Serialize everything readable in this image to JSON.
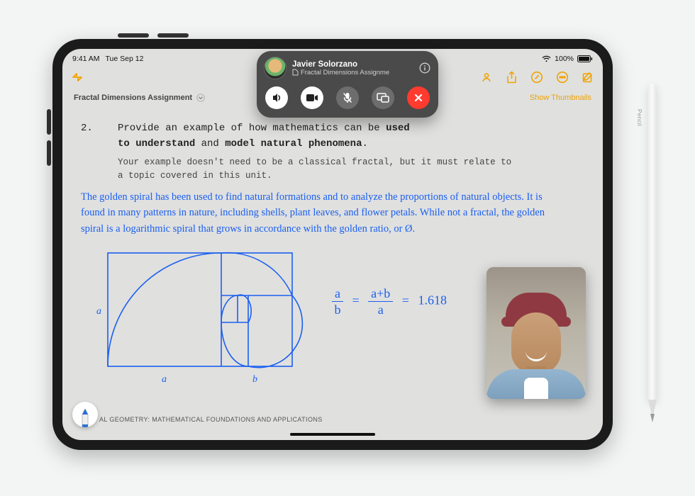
{
  "status": {
    "time": "9:41 AM",
    "date": "Tue Sep 12",
    "battery_pct": "100%"
  },
  "toolbar": {
    "icons": {
      "collapse": "collapse-icon",
      "collab": "collaborate-icon",
      "share": "share-icon",
      "markup": "markup-icon",
      "more": "ellipsis-circle-icon",
      "compose": "compose-icon"
    }
  },
  "titlebar": {
    "doc_title": "Fractal Dimensions Assignment",
    "show_thumbs": "Show Thumbnails"
  },
  "document": {
    "q_num": "2.",
    "q_line1_a": "Provide an example of how mathematics can be ",
    "q_line1_b": "used",
    "q_line2_a": "to understand",
    "q_line2_b": " and ",
    "q_line2_c": "model natural phenomena",
    "q_line2_d": ".",
    "hint": "Your example doesn't need to be a classical fractal, but it must relate to a topic covered in this unit.",
    "handwriting": "The golden spiral has been used to find natural formations and to analyze the proportions of natural objects. It is found in many patterns in nature, including shells, plant leaves, and flower petals. While not a fractal, the golden spiral is a logarithmic spiral that grows in accordance with the golden ratio, or Ø.",
    "diagram": {
      "side_a": "a",
      "side_a2": "a",
      "side_b": "b"
    },
    "equation": {
      "lhs_top": "a",
      "lhs_bot": "b",
      "rhs_top": "a+b",
      "rhs_bot": "a",
      "value": "1.618"
    },
    "footer": "AL GEOMETRY: MATHEMATICAL FOUNDATIONS AND APPLICATIONS"
  },
  "facetime": {
    "name": "Javier Solorzano",
    "subtitle": "Fractal Dimensions Assignme"
  },
  "pencil": {
    "label": " Pencil"
  }
}
